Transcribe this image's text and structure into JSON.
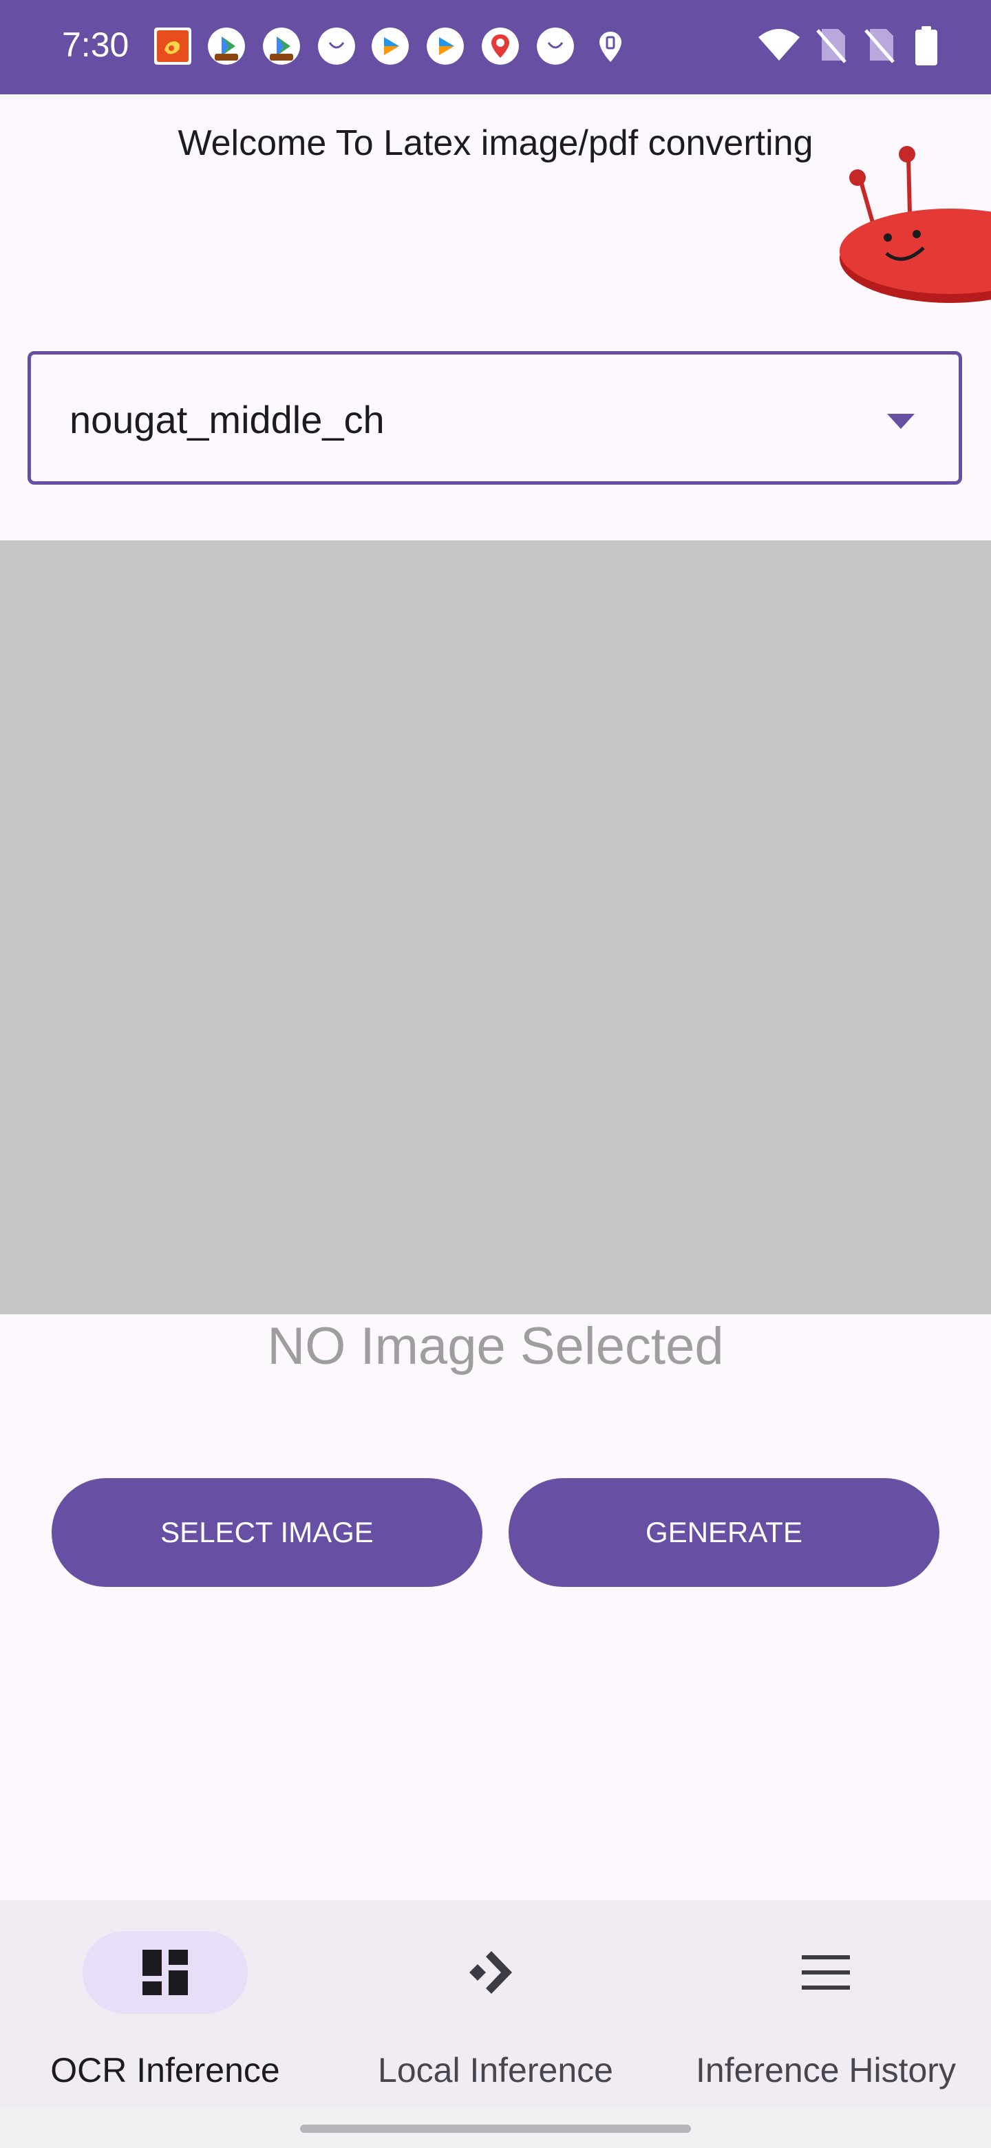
{
  "status_bar": {
    "time": "7:30",
    "bg_color": "#6750a4",
    "notification_icons": [
      "weibo-icon",
      "play-store-icon",
      "play-store-icon",
      "smile-icon",
      "video-play-icon",
      "video-play-icon",
      "baidu-map-icon",
      "smile-icon",
      "location-icon"
    ],
    "system_icons": [
      "wifi-icon",
      "no-sim-icon",
      "no-sim-icon",
      "battery-icon"
    ]
  },
  "header": {
    "title": "Welcome To Latex image/pdf converting"
  },
  "model_dropdown": {
    "selected_value": "nougat_middle_ch"
  },
  "image_preview": {
    "placeholder_text": "NO Image Selected"
  },
  "actions": {
    "select_label": "SELECT IMAGE",
    "generate_label": "GENERATE"
  },
  "bottom_nav": {
    "items": [
      {
        "label": "OCR Inference",
        "icon": "dashboard-icon",
        "active": true
      },
      {
        "label": "Local Inference",
        "icon": "arrow-right-icon",
        "active": false
      },
      {
        "label": "Inference History",
        "icon": "menu-icon",
        "active": false
      }
    ]
  },
  "colors": {
    "primary": "#6750a4",
    "surface": "#fdf8fd",
    "placeholder_bg": "#c6c5c6",
    "nav_bg": "#f1ecf4",
    "active_pill": "#e8def8"
  }
}
